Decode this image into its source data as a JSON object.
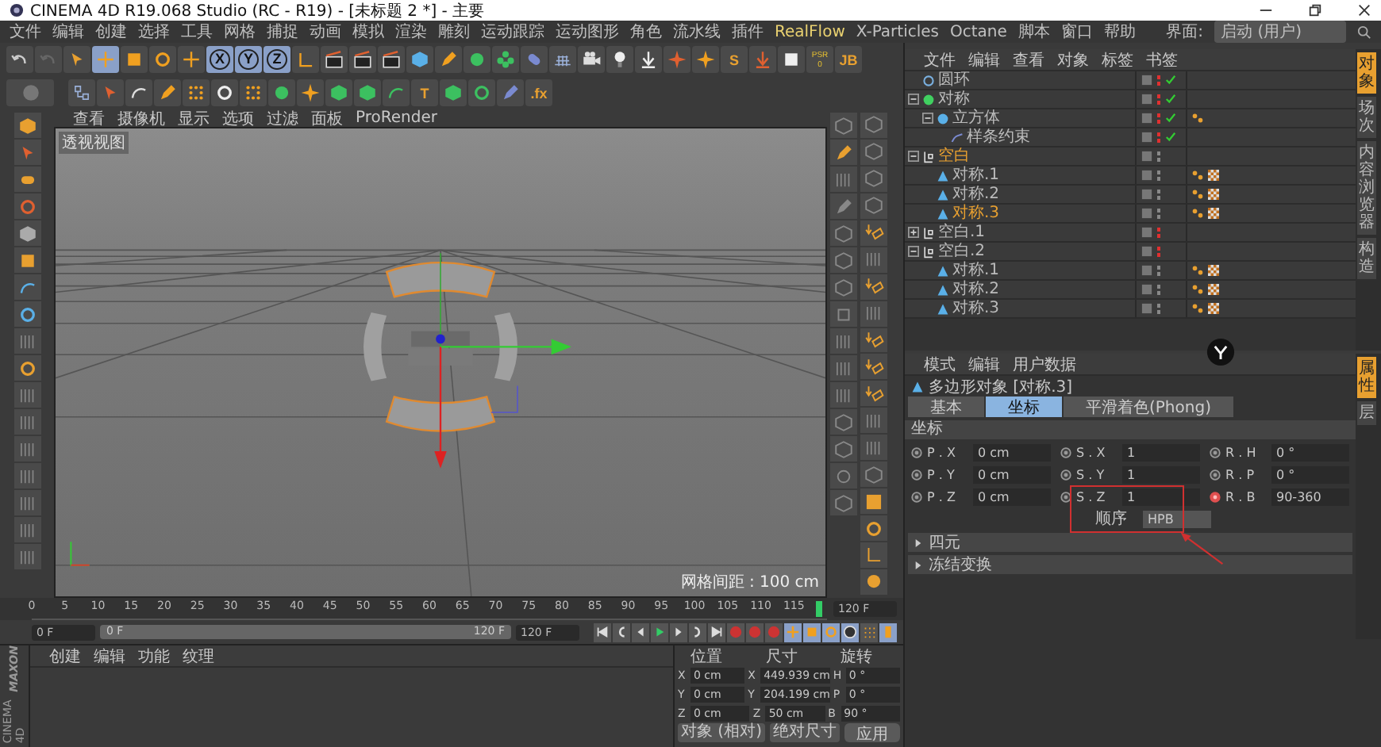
{
  "window": {
    "title": "CINEMA 4D R19.068 Studio (RC - R19) - [未标题 2 *] - 主要"
  },
  "menu": [
    {
      "label": "文件",
      "highlighted": false
    },
    {
      "label": "编辑",
      "highlighted": false
    },
    {
      "label": "创建",
      "highlighted": false
    },
    {
      "label": "选择",
      "highlighted": false
    },
    {
      "label": "工具",
      "highlighted": false
    },
    {
      "label": "网格",
      "highlighted": false
    },
    {
      "label": "捕捉",
      "highlighted": false
    },
    {
      "label": "动画",
      "highlighted": false
    },
    {
      "label": "模拟",
      "highlighted": false
    },
    {
      "label": "渲染",
      "highlighted": false
    },
    {
      "label": "雕刻",
      "highlighted": false
    },
    {
      "label": "运动跟踪",
      "highlighted": false
    },
    {
      "label": "运动图形",
      "highlighted": false
    },
    {
      "label": "角色",
      "highlighted": false
    },
    {
      "label": "流水线",
      "highlighted": false
    },
    {
      "label": "插件",
      "highlighted": false
    },
    {
      "label": "RealFlow",
      "highlighted": true
    },
    {
      "label": "X-Particles",
      "highlighted": false
    },
    {
      "label": "Octane",
      "highlighted": false
    },
    {
      "label": "脚本",
      "highlighted": false
    },
    {
      "label": "窗口",
      "highlighted": false
    },
    {
      "label": "帮助",
      "highlighted": false
    }
  ],
  "layout": {
    "label": "界面:",
    "value": "启动 (用户)"
  },
  "toolbar_1": [
    {
      "kind": "undo",
      "selected": false
    },
    {
      "kind": "redo",
      "selected": false
    },
    {
      "kind": "live-select",
      "selected": false
    },
    {
      "kind": "move",
      "selected": true
    },
    {
      "kind": "scale",
      "selected": false
    },
    {
      "kind": "rotate",
      "selected": false
    },
    {
      "kind": "add",
      "selected": false
    },
    {
      "kind": "axis",
      "label": "X",
      "selected": true
    },
    {
      "kind": "axis",
      "label": "Y",
      "selected": true
    },
    {
      "kind": "axis",
      "label": "Z",
      "selected": true
    },
    {
      "kind": "coordinates",
      "selected": false
    },
    {
      "kind": "render-view",
      "selected": false
    },
    {
      "kind": "render",
      "selected": false
    },
    {
      "kind": "render-settings",
      "selected": false
    },
    {
      "kind": "cube",
      "selected": false
    },
    {
      "kind": "pen",
      "selected": false
    },
    {
      "kind": "subdivide",
      "selected": false
    },
    {
      "kind": "cloner",
      "selected": false
    },
    {
      "kind": "deformer",
      "selected": false
    },
    {
      "kind": "floor",
      "selected": false
    },
    {
      "kind": "camera",
      "selected": false
    },
    {
      "kind": "light",
      "selected": false
    },
    {
      "kind": "download",
      "selected": false
    },
    {
      "kind": "emitter",
      "selected": false
    },
    {
      "kind": "sparkle",
      "selected": false
    },
    {
      "kind": "letter",
      "label": "S",
      "selected": false
    },
    {
      "kind": "drop",
      "selected": false
    },
    {
      "kind": "frame",
      "selected": false
    },
    {
      "kind": "psr",
      "label": "PSR",
      "value": "0",
      "selected": false
    },
    {
      "kind": "letter",
      "label": "JB",
      "selected": false
    }
  ],
  "toolbar_2": [
    {
      "kind": "tree",
      "selected": false
    },
    {
      "kind": "lock",
      "selected": false
    },
    {
      "kind": "spline-select",
      "selected": false
    },
    {
      "kind": "spline-pen",
      "selected": false
    },
    {
      "kind": "points",
      "selected": false
    },
    {
      "kind": "edges",
      "selected": false
    },
    {
      "kind": "polygons",
      "selected": false
    },
    {
      "kind": "gem",
      "selected": false
    },
    {
      "kind": "sparkle",
      "selected": false
    },
    {
      "kind": "cube-green",
      "selected": false
    },
    {
      "kind": "cube-green",
      "selected": false
    },
    {
      "kind": "arc",
      "selected": false
    },
    {
      "kind": "letter",
      "label": "T",
      "selected": false
    },
    {
      "kind": "cube-green",
      "selected": false
    },
    {
      "kind": "spiral",
      "selected": false
    },
    {
      "kind": "brush",
      "selected": false
    },
    {
      "kind": "letter",
      "label": ".fx",
      "selected": false
    }
  ],
  "viewport": {
    "menu": [
      "查看",
      "摄像机",
      "显示",
      "选项",
      "过滤",
      "面板",
      "ProRender"
    ],
    "label": "透视视图",
    "grid_spacing": "网格间距 : 100 cm"
  },
  "object_manager": {
    "menu": [
      "文件",
      "编辑",
      "查看",
      "对象",
      "标签",
      "书签"
    ],
    "objects": [
      {
        "name": "圆环",
        "kind": "torus",
        "selected": false,
        "hidden": true,
        "check": true
      },
      {
        "name": "对称",
        "kind": "symmetry",
        "selected": false,
        "hidden": true,
        "check": true,
        "expanded": true,
        "children": [
          {
            "name": "立方体",
            "kind": "cube",
            "selected": false,
            "hidden": true,
            "check": true,
            "tags": [
              {
                "kind": "phong"
              }
            ],
            "expanded": true,
            "children": [
              {
                "name": "样条约束",
                "kind": "constraint",
                "selected": false,
                "hidden": true,
                "check": true
              }
            ]
          }
        ]
      },
      {
        "name": "空白",
        "kind": "null",
        "selected": true,
        "hidden": false,
        "check": false,
        "expanded": true,
        "children": [
          {
            "name": "对称.1",
            "kind": "polygon",
            "selected": false,
            "hidden": false,
            "check": false,
            "tags": [
              {
                "kind": "phong"
              },
              {
                "kind": "material"
              }
            ]
          },
          {
            "name": "对称.2",
            "kind": "polygon",
            "selected": false,
            "hidden": false,
            "check": false,
            "tags": [
              {
                "kind": "phong"
              },
              {
                "kind": "material"
              }
            ]
          },
          {
            "name": "对称.3",
            "kind": "polygon",
            "selected": true,
            "hidden": false,
            "check": false,
            "tags": [
              {
                "kind": "phong"
              },
              {
                "kind": "material"
              }
            ]
          }
        ]
      },
      {
        "name": "空白.1",
        "kind": "null",
        "selected": false,
        "hidden": true,
        "check": false,
        "expanded": false
      },
      {
        "name": "空白.2",
        "kind": "null",
        "selected": false,
        "hidden": true,
        "check": false,
        "expanded": true,
        "children": [
          {
            "name": "对称.1",
            "kind": "polygon",
            "selected": false,
            "hidden": false,
            "check": false,
            "tags": [
              {
                "kind": "phong"
              },
              {
                "kind": "material"
              }
            ]
          },
          {
            "name": "对称.2",
            "kind": "polygon",
            "selected": false,
            "hidden": false,
            "check": false,
            "tags": [
              {
                "kind": "phong"
              },
              {
                "kind": "material"
              }
            ]
          },
          {
            "name": "对称.3",
            "kind": "polygon",
            "selected": false,
            "hidden": false,
            "check": false,
            "tags": [
              {
                "kind": "phong"
              },
              {
                "kind": "material"
              }
            ]
          }
        ]
      }
    ],
    "side_tabs": [
      {
        "label": "对象",
        "selected": true
      },
      {
        "label": "场次",
        "selected": false
      },
      {
        "label": "内容浏览器",
        "selected": false
      },
      {
        "label": "构造",
        "selected": false
      }
    ]
  },
  "attributes": {
    "menu": [
      "模式",
      "编辑",
      "用户数据"
    ],
    "title": "多边形对象 [对称.3]",
    "tabs": [
      {
        "label": "基本",
        "selected": false
      },
      {
        "label": "坐标",
        "selected": true
      },
      {
        "label": "平滑着色(Phong)",
        "selected": false
      }
    ],
    "section": "坐标",
    "rows": [
      [
        {
          "label": "P . X",
          "value": "0 cm",
          "keyed": false
        },
        {
          "label": "S . X",
          "value": "1",
          "keyed": false
        },
        {
          "label": "R . H",
          "value": "0 °",
          "keyed": false
        }
      ],
      [
        {
          "label": "P . Y",
          "value": "0 cm",
          "keyed": false
        },
        {
          "label": "S . Y",
          "value": "1",
          "keyed": false
        },
        {
          "label": "R . P",
          "value": "0 °",
          "keyed": false
        }
      ],
      [
        {
          "label": "P . Z",
          "value": "0 cm",
          "keyed": false
        },
        {
          "label": "S . Z",
          "value": "1",
          "keyed": false
        },
        {
          "label": "R . B",
          "value": "90-360",
          "keyed": true
        }
      ]
    ],
    "order": {
      "label": "顺序",
      "value": "HPB"
    },
    "groups": [
      {
        "label": "四元",
        "expanded": false
      },
      {
        "label": "冻结变换",
        "expanded": false
      }
    ],
    "side_tabs": [
      {
        "label": "属性",
        "selected": true
      },
      {
        "label": "层",
        "selected": false
      }
    ]
  },
  "timeline": {
    "ticks": [
      "0",
      "5",
      "10",
      "15",
      "20",
      "25",
      "30",
      "35",
      "40",
      "45",
      "50",
      "55",
      "60",
      "65",
      "70",
      "75",
      "80",
      "85",
      "90",
      "95",
      "100",
      "105",
      "110",
      "115"
    ],
    "end": "120 F",
    "playhead": {
      "level": 0.99
    }
  },
  "transport": {
    "start": "0 F",
    "range_start": "0 F",
    "range_end": "120 F",
    "end": "120 F"
  },
  "materials": {
    "menu": [
      "创建",
      "编辑",
      "功能",
      "纹理"
    ]
  },
  "coordinates": {
    "headers": [
      "位置",
      "尺寸",
      "旋转"
    ],
    "rows": [
      {
        "axis": "X",
        "position": "0 cm",
        "size_axis": "X",
        "size": "449.939 cm",
        "rot_axis": "H",
        "rotation": "0 °"
      },
      {
        "axis": "Y",
        "position": "0 cm",
        "size_axis": "Y",
        "size": "204.199 cm",
        "rot_axis": "P",
        "rotation": "0 °"
      },
      {
        "axis": "Z",
        "position": "0 cm",
        "size_axis": "Z",
        "size": "50 cm",
        "rot_axis": "B",
        "rotation": "90 °"
      }
    ],
    "mode": "对象 (相对)",
    "size_mode": "绝对尺寸",
    "apply": "应用"
  },
  "brand": {
    "company": "MAXON",
    "product": "CINEMA 4D"
  }
}
